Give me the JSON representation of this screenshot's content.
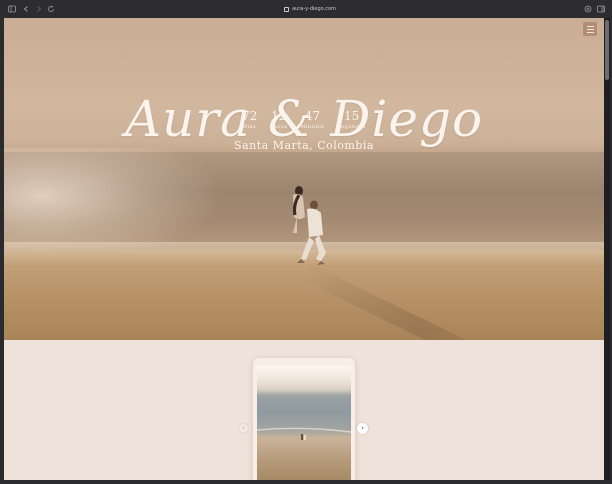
{
  "browser": {
    "url": "aura-y-diego.com",
    "icons": [
      "sidebar-icon",
      "back-icon",
      "forward-icon",
      "reload-icon",
      "share-icon",
      "tabs-icon"
    ]
  },
  "hero": {
    "title": "Aura & Diego",
    "countdown": [
      {
        "value": "72",
        "label": "Días"
      },
      {
        "value": "12",
        "label": "Horas"
      },
      {
        "value": "47",
        "label": "Minutos"
      },
      {
        "value": "15",
        "label": "Segundos"
      }
    ],
    "location": "Santa Marta, Colombia",
    "menu_icon": "hamburger-menu-icon"
  },
  "gallery": {
    "prev_icon": "chevron-left-icon",
    "next_icon": "chevron-right-icon",
    "prev_glyph": "‹",
    "next_glyph": "›"
  },
  "colors": {
    "accent": "#b48e74",
    "background": "#efe2da",
    "text_light": "#fbf4ec"
  }
}
